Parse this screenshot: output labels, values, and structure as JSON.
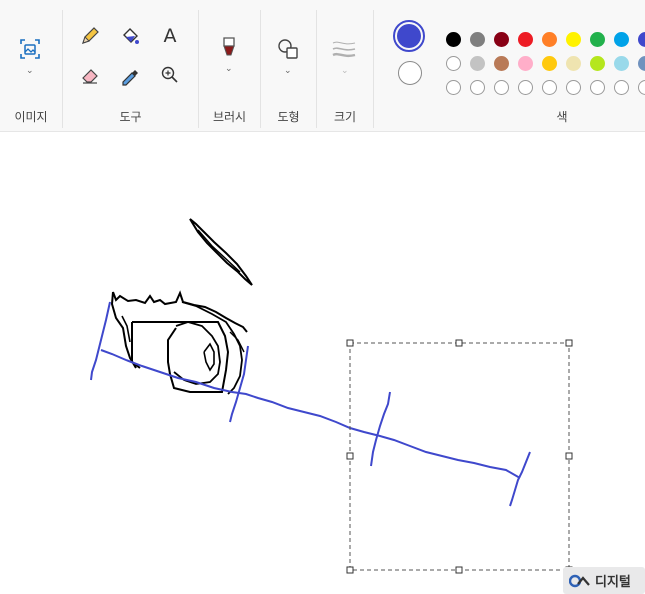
{
  "ribbon": {
    "groups": {
      "image": {
        "label": "이미지"
      },
      "tools": {
        "label": "도구"
      },
      "brushes": {
        "label": "브러시"
      },
      "shapes": {
        "label": "도형"
      },
      "size": {
        "label": "크기"
      },
      "colors": {
        "label": "색"
      }
    },
    "tools": [
      "pencil-icon",
      "fill-bucket-icon",
      "text-icon",
      "eraser-icon",
      "color-picker-icon",
      "magnifier-icon"
    ],
    "text_tool_glyph": "A",
    "color1": "#3f48cc",
    "color2": "#ffffff",
    "palette_row1": [
      "#000000",
      "#7f7f7f",
      "#880015",
      "#ed1c24",
      "#ff7f27",
      "#fff200",
      "#22b14c",
      "#00a2e8",
      "#3f48cc"
    ],
    "palette_row2": [
      "#ffffff",
      "#c3c3c3",
      "#b97a57",
      "#ffaec9",
      "#ffc90e",
      "#efe4b0",
      "#b5e61d",
      "#99d9ea",
      "#7092be"
    ]
  },
  "watermark": {
    "text": "디지털"
  }
}
